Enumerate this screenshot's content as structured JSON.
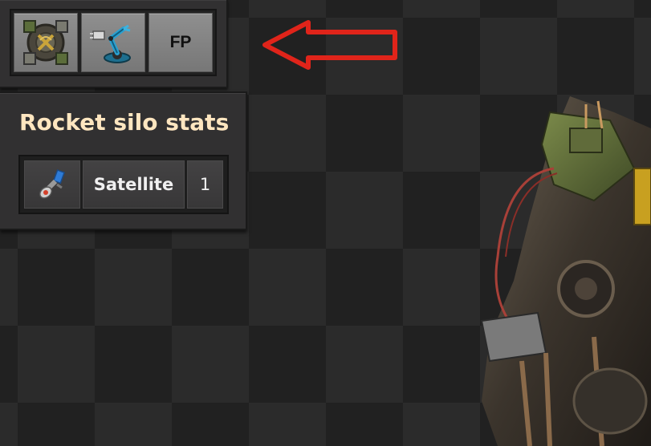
{
  "toolbar": {
    "buttons": [
      {
        "icon": "rocket-silo-icon"
      },
      {
        "icon": "inserter-icon"
      },
      {
        "label": "FP"
      }
    ]
  },
  "stats_panel": {
    "title": "Rocket silo stats",
    "rows": [
      {
        "icon": "satellite-icon",
        "name": "Satellite",
        "count": "1"
      }
    ]
  },
  "colors": {
    "arrow": "#e0241a",
    "title_text": "#ffe6c0"
  }
}
